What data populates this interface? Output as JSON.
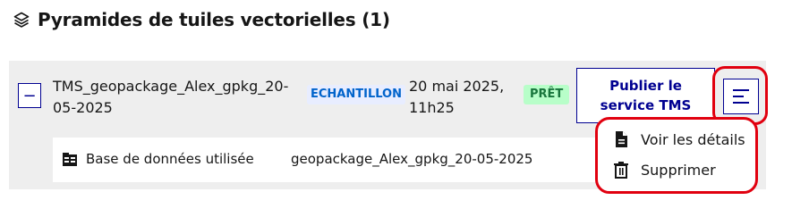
{
  "section": {
    "title": "Pyramides de tuiles vectorielles (1)",
    "icon": "layers-icon"
  },
  "tile": {
    "toggle_label": "−",
    "name": "TMS_geopackage_Alex_gpkg_20-05-2025",
    "badge_sample": "ECHANTILLON",
    "date": "20 mai 2025, 11h25",
    "badge_ready": "PRÊT",
    "publish_label": "Publier le service TMS",
    "menu_icon": "menu-lines-icon"
  },
  "detail": {
    "icon": "database-icon",
    "label": "Base de données utilisée",
    "value": "geopackage_Alex_gpkg_20-05-2025"
  },
  "dropdown": {
    "items": [
      {
        "label": "Voir les détails",
        "icon": "document-icon"
      },
      {
        "label": "Supprimer",
        "icon": "trash-icon"
      }
    ]
  },
  "colors": {
    "primary": "#000091",
    "highlight": "#e1000f",
    "sample_bg": "#e8edff",
    "sample_fg": "#0063cb",
    "ready_bg": "#b8fec9",
    "ready_fg": "#18753c",
    "card_bg": "#eeeeee"
  }
}
